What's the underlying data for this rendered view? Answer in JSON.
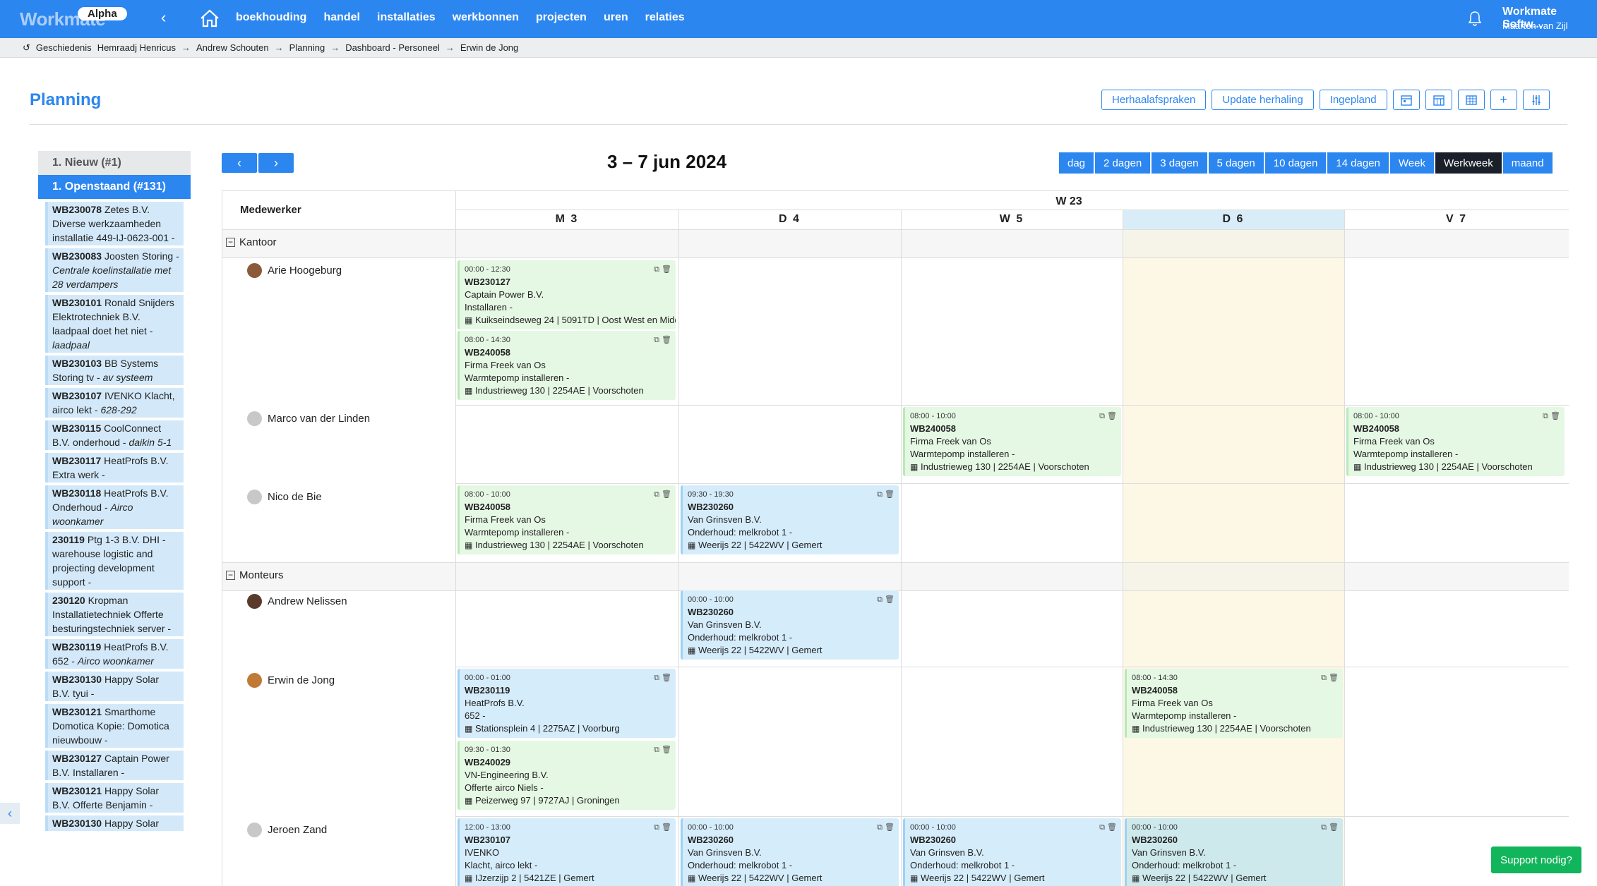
{
  "app": {
    "logo": "Workmate",
    "badge": "Alpha",
    "nav": [
      "boekhouding",
      "handel",
      "installaties",
      "werkbonnen",
      "projecten",
      "uren",
      "relaties"
    ],
    "company": "Workmate Softw...",
    "user": "Maarten van Zijl"
  },
  "breadcrumbs": {
    "history": "Geschiedenis",
    "items": [
      "Hemraadj Henricus",
      "Andrew Schouten",
      "Planning",
      "Dashboard - Personeel",
      "Erwin de Jong"
    ]
  },
  "page": {
    "title": "Planning",
    "tools": [
      "Herhaalafspraken",
      "Update herhaling",
      "Ingepland"
    ]
  },
  "sidebar": {
    "group_new": "1. Nieuw (#1)",
    "group_open": "1. Openstaand (#131)",
    "items": [
      {
        "code": "WB230078",
        "text": "Zetes B.V. Diverse werkzaamheden installatie 449-IJ-0623-001 -",
        "italic": ""
      },
      {
        "code": "WB230083",
        "text": "Joosten Storing -",
        "italic": "Centrale koelinstallatie met 28 verdampers"
      },
      {
        "code": "WB230101",
        "text": "Ronald Snijders Elektrotechniek B.V. laadpaal doet het niet -",
        "italic": "laadpaal"
      },
      {
        "code": "WB230103",
        "text": "BB Systems Storing tv -",
        "italic": "av systeem"
      },
      {
        "code": "WB230107",
        "text": "IVENKO Klacht, airco lekt -",
        "italic": "628-292"
      },
      {
        "code": "WB230115",
        "text": "CoolConnect B.V. onderhoud -",
        "italic": "daikin 5-1"
      },
      {
        "code": "WB230117",
        "text": "HeatProfs B.V. Extra werk -",
        "italic": ""
      },
      {
        "code": "WB230118",
        "text": "HeatProfs B.V. Onderhoud -",
        "italic": "Airco woonkamer"
      },
      {
        "code": "230119",
        "text": "Ptg 1-3 B.V. DHI - warehouse logistic and projecting development support -",
        "italic": ""
      },
      {
        "code": "230120",
        "text": "Kropman Installatietechniek Offerte besturingstechniek server -",
        "italic": ""
      },
      {
        "code": "WB230119",
        "text": "HeatProfs B.V. 652 -",
        "italic": "Airco woonkamer"
      },
      {
        "code": "WB230130",
        "text": "Happy Solar B.V. tyui -",
        "italic": ""
      },
      {
        "code": "WB230121",
        "text": "Smarthome Domotica Kopie: Domotica nieuwbouw -",
        "italic": ""
      },
      {
        "code": "WB230127",
        "text": "Captain Power B.V. Installaren -",
        "italic": ""
      },
      {
        "code": "WB230121",
        "text": "Happy Solar B.V. Offerte Benjamin -",
        "italic": ""
      },
      {
        "code": "WB230130",
        "text": "Happy Solar",
        "italic": ""
      }
    ]
  },
  "calendar": {
    "date_range": "3 – 7 jun 2024",
    "views": [
      "dag",
      "2 dagen",
      "3 dagen",
      "5 dagen",
      "10 dagen",
      "14 dagen",
      "Week",
      "Werkweek",
      "maand"
    ],
    "active_view": "Werkweek",
    "employee_header": "Medewerker",
    "week": "W 23",
    "days": [
      "M 3",
      "D 4",
      "W 5",
      "D 6",
      "V 7"
    ],
    "today_index": 3,
    "groups": {
      "kantoor": "Kantoor",
      "monteurs": "Monteurs"
    },
    "employees": [
      "Arie Hoogeburg",
      "Marco van der Linden",
      "Nico de Bie",
      "Andrew Nelissen",
      "Erwin de Jong",
      "Jeroen Zand"
    ],
    "events": {
      "e1": {
        "time": "00:00 - 12:30",
        "code": "WB230127",
        "client": "Captain Power B.V.",
        "desc": "Installaren -",
        "addr": "Kuikseindseweg 24 | 5091TD | Oost West en Middelbeers"
      },
      "e2": {
        "time": "08:00 - 14:30",
        "code": "WB240058",
        "client": "Firma Freek van Os",
        "desc": "Warmtepomp installeren -",
        "addr": "Industrieweg 130 | 2254AE | Voorschoten"
      },
      "e3": {
        "time": "08:00 - 10:00",
        "code": "WB240058",
        "client": "Firma Freek van Os",
        "desc": "Warmtepomp installeren -",
        "addr": "Industrieweg 130 | 2254AE | Voorschoten"
      },
      "e4": {
        "time": "08:00 - 10:00",
        "code": "WB240058",
        "client": "Firma Freek van Os",
        "desc": "Warmtepomp installeren -",
        "addr": "Industrieweg 130 | 2254AE | Voorschoten"
      },
      "e5": {
        "time": "08:00 - 10:00",
        "code": "WB240058",
        "client": "Firma Freek van Os",
        "desc": "Warmtepomp installeren -",
        "addr": "Industrieweg 130 | 2254AE | Voorschoten"
      },
      "e6": {
        "time": "09:30 - 19:30",
        "code": "WB230260",
        "client": "Van Grinsven B.V.",
        "desc": "Onderhoud: melkrobot 1 -",
        "addr": "Weerijs 22 | 5422WV | Gemert"
      },
      "e7": {
        "time": "00:00 - 10:00",
        "code": "WB230260",
        "client": "Van Grinsven B.V.",
        "desc": "Onderhoud: melkrobot 1 -",
        "addr": "Weerijs 22 | 5422WV | Gemert"
      },
      "e8": {
        "time": "00:00 - 01:00",
        "code": "WB230119",
        "client": "HeatProfs B.V.",
        "desc": "652 -",
        "addr": "Stationsplein 4 | 2275AZ | Voorburg"
      },
      "e9": {
        "time": "09:30 - 01:30",
        "code": "WB240029",
        "client": "VN-Engineering B.V.",
        "desc": "Offerte airco Niels -",
        "addr": "Peizerweg 97 | 9727AJ | Groningen"
      },
      "e10": {
        "time": "08:00 - 14:30",
        "code": "WB240058",
        "client": "Firma Freek van Os",
        "desc": "Warmtepomp installeren -",
        "addr": "Industrieweg 130 | 2254AE | Voorschoten"
      },
      "e11": {
        "time": "12:00 - 13:00",
        "code": "WB230107",
        "client": "IVENKO",
        "desc": "Klacht, airco lekt -",
        "addr": "IJzerzijp 2 | 5421ZE | Gemert"
      },
      "e12": {
        "time": "00:00 - 10:00",
        "code": "WB230260",
        "client": "Van Grinsven B.V.",
        "desc": "Onderhoud: melkrobot 1 -",
        "addr": "Weerijs 22 | 5422WV | Gemert"
      },
      "e13": {
        "time": "00:00 - 10:00",
        "code": "WB230260",
        "client": "Van Grinsven B.V.",
        "desc": "Onderhoud: melkrobot 1 -",
        "addr": "Weerijs 22 | 5422WV | Gemert"
      },
      "e14": {
        "time": "00:00 - 10:00",
        "code": "WB230260",
        "client": "Van Grinsven B.V.",
        "desc": "Onderhoud: melkrobot 1 -",
        "addr": "Weerijs 22 | 5422WV | Gemert"
      }
    }
  },
  "support": "Support nodig?",
  "colors": {
    "primary": "#2c86f0",
    "active_view": "#1a1f2a",
    "event_green": "#e5f8e4",
    "event_blue": "#d5ecfb",
    "today": "#fdf7e6",
    "support": "#11b55b"
  }
}
